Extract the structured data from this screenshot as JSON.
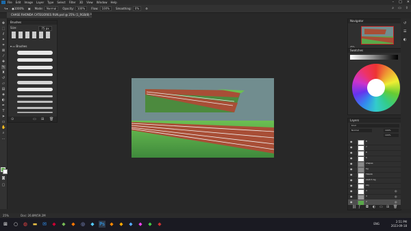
{
  "menu": {
    "items": [
      "File",
      "Edit",
      "Image",
      "Layer",
      "Type",
      "Select",
      "Filter",
      "3D",
      "View",
      "Window",
      "Help"
    ],
    "window_controls": [
      "–",
      "□",
      "✕"
    ]
  },
  "options": {
    "size": "1000%",
    "mode_label": "Mode:",
    "mode_value": "Normal",
    "opacity_label": "Opacity:",
    "opacity_value": "100%",
    "flow_label": "Flow:",
    "flow_value": "100%",
    "smoothing_label": "Smoothing:",
    "smoothing_value": "0%"
  },
  "document": {
    "tab_title": "CHASE RHONDA CATEGORIES RUN.psd @ 25% (1_RGB/8) *"
  },
  "brushes_panel": {
    "title": "Brushes",
    "size_label": "Size:",
    "size_value": "75 px",
    "folder_label": "Brushes"
  },
  "navigator": {
    "title": "Navigator",
    "zoom": "25%"
  },
  "color_panel": {
    "title": "Swatches"
  },
  "layers_panel": {
    "title": "Layers",
    "kind_label": "Kind",
    "blend_mode": "Normal",
    "opacity_value": "100%",
    "fill_value": "100%",
    "layers": [
      {
        "name": "8",
        "visible": true
      },
      {
        "name": "7",
        "visible": true
      },
      {
        "name": "6",
        "visible": true
      },
      {
        "name": "5",
        "visible": true
      },
      {
        "name": "shapes",
        "visible": true
      },
      {
        "name": "bg",
        "visible": true
      },
      {
        "name": "TRACK",
        "visible": true
      },
      {
        "name": "sketch bg",
        "visible": true
      },
      {
        "name": "sky",
        "visible": true
      },
      {
        "name": "4",
        "visible": true
      },
      {
        "name": "3",
        "visible": true
      },
      {
        "name": "2",
        "visible": true
      },
      {
        "name": "1",
        "visible": true
      }
    ]
  },
  "status": {
    "zoom": "25%",
    "doc": "Doc: 26.8M/59.2M"
  },
  "taskbar": {
    "time": "2:51 PM",
    "date": "2023-09-18",
    "lang": "ENG"
  },
  "colors": {
    "track": "#a84e36",
    "grass": "#5aa84a",
    "sky": "#718d8f",
    "taskbar": "#1a1a22"
  }
}
